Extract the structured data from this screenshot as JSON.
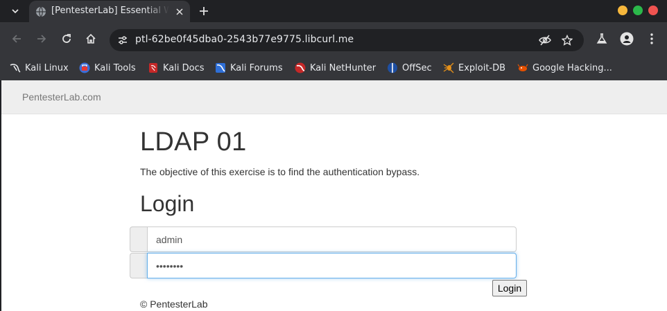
{
  "browser": {
    "tab": {
      "title": "[PentesterLab] Essential Web Exploitation"
    },
    "address": {
      "url": "ptl-62be0f45dba0-2543b77e9775.libcurl.me"
    }
  },
  "bookmarks": [
    {
      "label": "Kali Linux",
      "icon": "kali-dragon-icon"
    },
    {
      "label": "Kali Tools",
      "icon": "kali-tools-icon"
    },
    {
      "label": "Kali Docs",
      "icon": "kali-docs-icon"
    },
    {
      "label": "Kali Forums",
      "icon": "kali-forums-icon"
    },
    {
      "label": "Kali NetHunter",
      "icon": "nethunter-icon"
    },
    {
      "label": "OffSec",
      "icon": "offsec-icon"
    },
    {
      "label": "Exploit-DB",
      "icon": "exploit-db-icon"
    },
    {
      "label": "Google Hacking...",
      "icon": "ghdb-icon"
    }
  ],
  "page": {
    "brand": "PentesterLab.com",
    "title": "LDAP 01",
    "description": "The objective of this exercise is to find the authentication bypass.",
    "form_title": "Login",
    "username_value": "admin",
    "password_value": "password",
    "login_button": "Login",
    "footer": "© PentesterLab"
  },
  "colors": {
    "focus_border": "#66afe9",
    "navbar_bg": "#eeeeee",
    "chrome_dark": "#202124",
    "chrome_toolbar": "#35363a"
  }
}
